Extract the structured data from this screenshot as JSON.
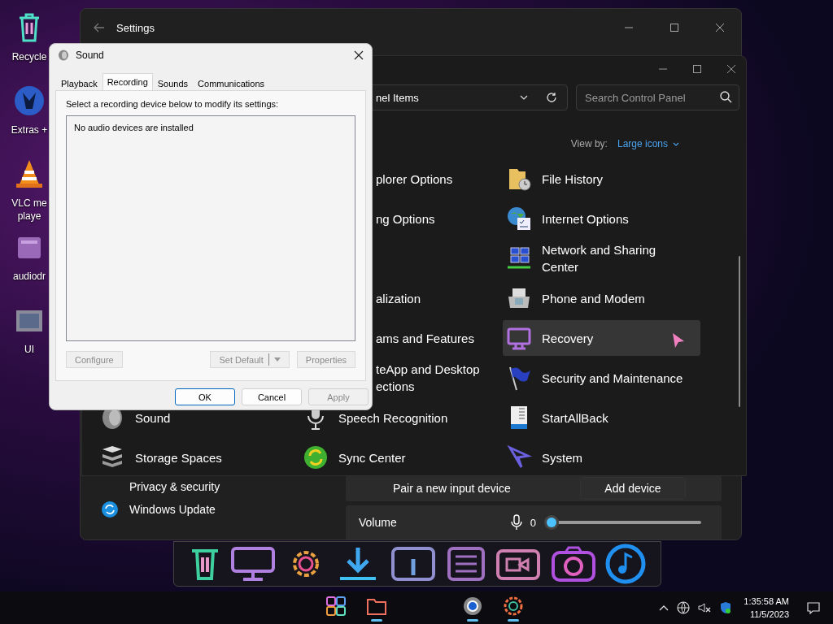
{
  "desktop_icons": [
    {
      "label": "Recycle"
    },
    {
      "label": "Extras +"
    },
    {
      "label": "VLC me playe"
    },
    {
      "label": "audiodr"
    },
    {
      "label": "UI"
    }
  ],
  "settings_window": {
    "title": "Settings",
    "sidebar": {
      "items": [
        {
          "label": "Privacy & security"
        },
        {
          "label": "Windows Update"
        }
      ]
    },
    "pair_input": {
      "label": "Pair a new input device",
      "button": "Add device"
    },
    "volume": {
      "label": "Volume",
      "reading": "0",
      "level": 0
    }
  },
  "control_panel": {
    "address": "nel Items",
    "search": {
      "placeholder": "Search Control Panel"
    },
    "view_by": {
      "label": "View by:",
      "value": "Large icons"
    },
    "rows": [
      {
        "cells": [
          "",
          {
            "kind": "cut",
            "label": "plorer Options"
          },
          {
            "kind": "full",
            "label": "File History",
            "highlighted": false
          }
        ]
      },
      {
        "cells": [
          "",
          {
            "kind": "cut",
            "label": "ng Options"
          },
          {
            "kind": "full",
            "label": "Internet Options",
            "highlighted": false
          }
        ]
      },
      {
        "cells": [
          "",
          "",
          {
            "kind": "full",
            "label": "Network and Sharing Center",
            "highlighted": false
          }
        ]
      },
      {
        "cells": [
          "",
          {
            "kind": "cut",
            "label": "alization"
          },
          {
            "kind": "full",
            "label": "Phone and Modem",
            "highlighted": false
          }
        ]
      },
      {
        "cells": [
          "",
          {
            "kind": "cut",
            "label": "ams and Features"
          },
          {
            "kind": "full",
            "label": "Recovery",
            "highlighted": true
          }
        ]
      },
      {
        "cells": [
          "",
          {
            "kind": "cut",
            "label": "teApp and Desktop ections"
          },
          {
            "kind": "full",
            "label": "Security and Maintenance",
            "highlighted": false
          }
        ]
      },
      {
        "cells": [
          {
            "kind": "full",
            "label": "Sound",
            "highlighted": false
          },
          {
            "kind": "full",
            "label": "Speech Recognition",
            "highlighted": false
          },
          {
            "kind": "full",
            "label": "StartAllBack",
            "highlighted": false
          }
        ]
      },
      {
        "cells": [
          {
            "kind": "full",
            "label": "Storage Spaces",
            "highlighted": false
          },
          {
            "kind": "full",
            "label": "Sync Center",
            "highlighted": false
          },
          {
            "kind": "full",
            "label": "System",
            "highlighted": false
          }
        ]
      }
    ]
  },
  "sound_dialog": {
    "title": "Sound",
    "tabs": [
      {
        "label": "Playback",
        "selected": false
      },
      {
        "label": "Recording",
        "selected": true
      },
      {
        "label": "Sounds",
        "selected": false
      },
      {
        "label": "Communications",
        "selected": false
      }
    ],
    "instruction": "Select a recording device below to modify its settings:",
    "device_list": {
      "empty_text": "No audio devices are installed"
    },
    "device_buttons": [
      {
        "label": "Configure",
        "disabled": true
      },
      {
        "label": "Set Default",
        "disabled": true,
        "kind": "split"
      },
      {
        "label": "Properties",
        "disabled": true
      }
    ],
    "buttons": [
      {
        "label": "OK",
        "disabled": false,
        "default": true
      },
      {
        "label": "Cancel",
        "disabled": false,
        "default": false
      },
      {
        "label": "Apply",
        "disabled": true,
        "default": false
      }
    ]
  },
  "taskbar": {
    "apps": [
      {
        "running": false
      },
      {
        "running": true
      },
      {
        "running": true
      },
      {
        "running": true
      }
    ],
    "clock": {
      "time": "1:35:58 AM",
      "date": "11/5/2023"
    }
  }
}
